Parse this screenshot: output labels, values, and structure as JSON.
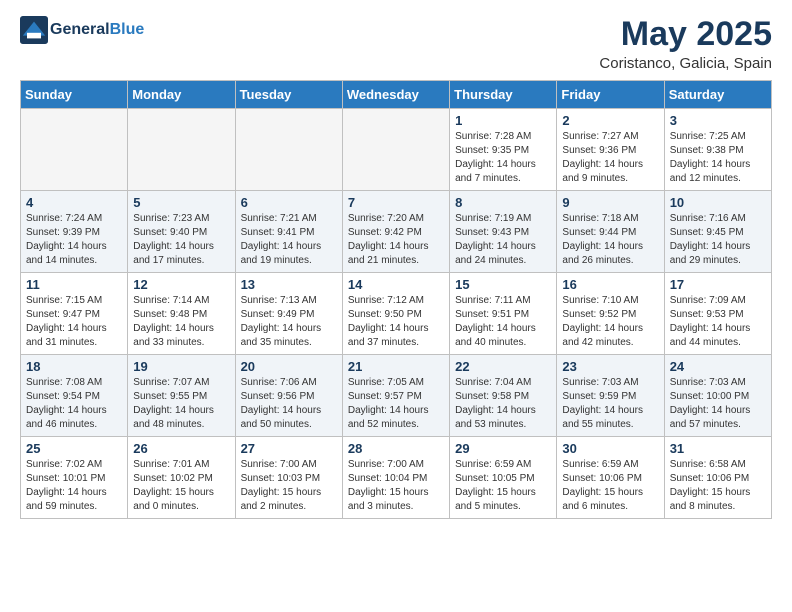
{
  "header": {
    "logo_line1": "General",
    "logo_line2": "Blue",
    "month_title": "May 2025",
    "location": "Coristanco, Galicia, Spain"
  },
  "days_of_week": [
    "Sunday",
    "Monday",
    "Tuesday",
    "Wednesday",
    "Thursday",
    "Friday",
    "Saturday"
  ],
  "weeks": [
    [
      {
        "day": "",
        "info": ""
      },
      {
        "day": "",
        "info": ""
      },
      {
        "day": "",
        "info": ""
      },
      {
        "day": "",
        "info": ""
      },
      {
        "day": "1",
        "info": "Sunrise: 7:28 AM\nSunset: 9:35 PM\nDaylight: 14 hours\nand 7 minutes."
      },
      {
        "day": "2",
        "info": "Sunrise: 7:27 AM\nSunset: 9:36 PM\nDaylight: 14 hours\nand 9 minutes."
      },
      {
        "day": "3",
        "info": "Sunrise: 7:25 AM\nSunset: 9:38 PM\nDaylight: 14 hours\nand 12 minutes."
      }
    ],
    [
      {
        "day": "4",
        "info": "Sunrise: 7:24 AM\nSunset: 9:39 PM\nDaylight: 14 hours\nand 14 minutes."
      },
      {
        "day": "5",
        "info": "Sunrise: 7:23 AM\nSunset: 9:40 PM\nDaylight: 14 hours\nand 17 minutes."
      },
      {
        "day": "6",
        "info": "Sunrise: 7:21 AM\nSunset: 9:41 PM\nDaylight: 14 hours\nand 19 minutes."
      },
      {
        "day": "7",
        "info": "Sunrise: 7:20 AM\nSunset: 9:42 PM\nDaylight: 14 hours\nand 21 minutes."
      },
      {
        "day": "8",
        "info": "Sunrise: 7:19 AM\nSunset: 9:43 PM\nDaylight: 14 hours\nand 24 minutes."
      },
      {
        "day": "9",
        "info": "Sunrise: 7:18 AM\nSunset: 9:44 PM\nDaylight: 14 hours\nand 26 minutes."
      },
      {
        "day": "10",
        "info": "Sunrise: 7:16 AM\nSunset: 9:45 PM\nDaylight: 14 hours\nand 29 minutes."
      }
    ],
    [
      {
        "day": "11",
        "info": "Sunrise: 7:15 AM\nSunset: 9:47 PM\nDaylight: 14 hours\nand 31 minutes."
      },
      {
        "day": "12",
        "info": "Sunrise: 7:14 AM\nSunset: 9:48 PM\nDaylight: 14 hours\nand 33 minutes."
      },
      {
        "day": "13",
        "info": "Sunrise: 7:13 AM\nSunset: 9:49 PM\nDaylight: 14 hours\nand 35 minutes."
      },
      {
        "day": "14",
        "info": "Sunrise: 7:12 AM\nSunset: 9:50 PM\nDaylight: 14 hours\nand 37 minutes."
      },
      {
        "day": "15",
        "info": "Sunrise: 7:11 AM\nSunset: 9:51 PM\nDaylight: 14 hours\nand 40 minutes."
      },
      {
        "day": "16",
        "info": "Sunrise: 7:10 AM\nSunset: 9:52 PM\nDaylight: 14 hours\nand 42 minutes."
      },
      {
        "day": "17",
        "info": "Sunrise: 7:09 AM\nSunset: 9:53 PM\nDaylight: 14 hours\nand 44 minutes."
      }
    ],
    [
      {
        "day": "18",
        "info": "Sunrise: 7:08 AM\nSunset: 9:54 PM\nDaylight: 14 hours\nand 46 minutes."
      },
      {
        "day": "19",
        "info": "Sunrise: 7:07 AM\nSunset: 9:55 PM\nDaylight: 14 hours\nand 48 minutes."
      },
      {
        "day": "20",
        "info": "Sunrise: 7:06 AM\nSunset: 9:56 PM\nDaylight: 14 hours\nand 50 minutes."
      },
      {
        "day": "21",
        "info": "Sunrise: 7:05 AM\nSunset: 9:57 PM\nDaylight: 14 hours\nand 52 minutes."
      },
      {
        "day": "22",
        "info": "Sunrise: 7:04 AM\nSunset: 9:58 PM\nDaylight: 14 hours\nand 53 minutes."
      },
      {
        "day": "23",
        "info": "Sunrise: 7:03 AM\nSunset: 9:59 PM\nDaylight: 14 hours\nand 55 minutes."
      },
      {
        "day": "24",
        "info": "Sunrise: 7:03 AM\nSunset: 10:00 PM\nDaylight: 14 hours\nand 57 minutes."
      }
    ],
    [
      {
        "day": "25",
        "info": "Sunrise: 7:02 AM\nSunset: 10:01 PM\nDaylight: 14 hours\nand 59 minutes."
      },
      {
        "day": "26",
        "info": "Sunrise: 7:01 AM\nSunset: 10:02 PM\nDaylight: 15 hours\nand 0 minutes."
      },
      {
        "day": "27",
        "info": "Sunrise: 7:00 AM\nSunset: 10:03 PM\nDaylight: 15 hours\nand 2 minutes."
      },
      {
        "day": "28",
        "info": "Sunrise: 7:00 AM\nSunset: 10:04 PM\nDaylight: 15 hours\nand 3 minutes."
      },
      {
        "day": "29",
        "info": "Sunrise: 6:59 AM\nSunset: 10:05 PM\nDaylight: 15 hours\nand 5 minutes."
      },
      {
        "day": "30",
        "info": "Sunrise: 6:59 AM\nSunset: 10:06 PM\nDaylight: 15 hours\nand 6 minutes."
      },
      {
        "day": "31",
        "info": "Sunrise: 6:58 AM\nSunset: 10:06 PM\nDaylight: 15 hours\nand 8 minutes."
      }
    ]
  ]
}
